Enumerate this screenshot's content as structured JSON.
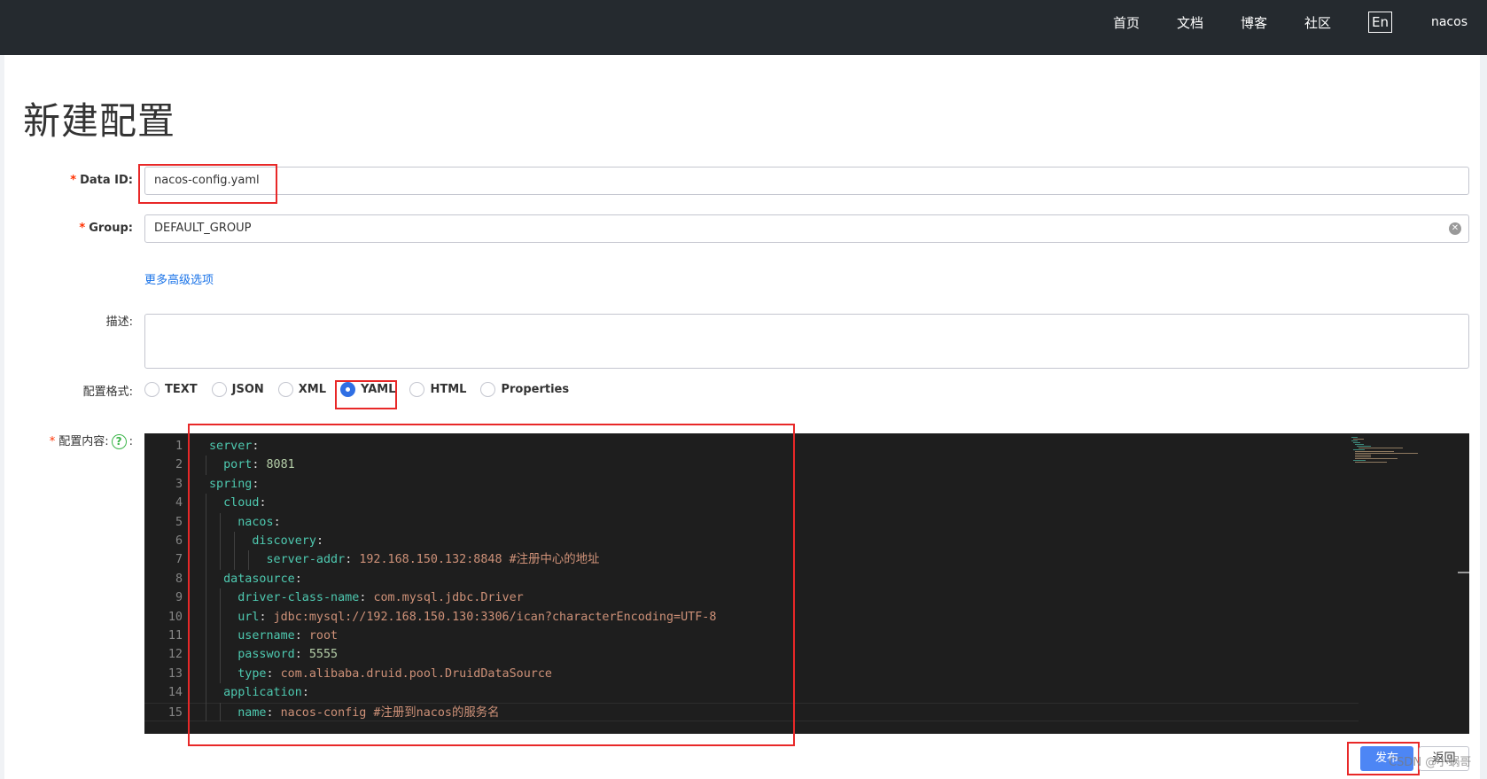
{
  "nav": {
    "items": [
      "首页",
      "文档",
      "博客",
      "社区"
    ],
    "lang": "En",
    "user": "nacos"
  },
  "page": {
    "title": "新建配置"
  },
  "form": {
    "data_id": {
      "label": "Data ID:",
      "value": "nacos-config.yaml"
    },
    "group": {
      "label": "Group:",
      "value": "DEFAULT_GROUP"
    },
    "more_options": "更多高级选项",
    "description": {
      "label": "描述:",
      "value": ""
    },
    "format": {
      "label": "配置格式:",
      "options": [
        "TEXT",
        "JSON",
        "XML",
        "YAML",
        "HTML",
        "Properties"
      ],
      "selected": "YAML"
    },
    "content": {
      "label": "配置内容:",
      "help": "?",
      "colon": ":"
    }
  },
  "editor": {
    "lines": [
      {
        "n": "1",
        "indent": "",
        "key": "server",
        "sep": ":",
        "val": "",
        "comment": ""
      },
      {
        "n": "2",
        "indent": "  ",
        "key": "port",
        "sep": ": ",
        "val": "8081",
        "comment": ""
      },
      {
        "n": "3",
        "indent": "",
        "key": "spring",
        "sep": ":",
        "val": "",
        "comment": ""
      },
      {
        "n": "4",
        "indent": "  ",
        "key": "cloud",
        "sep": ":",
        "val": "",
        "comment": ""
      },
      {
        "n": "5",
        "indent": "    ",
        "key": "nacos",
        "sep": ":",
        "val": "",
        "comment": ""
      },
      {
        "n": "6",
        "indent": "      ",
        "key": "discovery",
        "sep": ":",
        "val": "",
        "comment": ""
      },
      {
        "n": "7",
        "indent": "        ",
        "key": "server-addr",
        "sep": ": ",
        "val": "192.168.150.132:8848",
        "comment": " #注册中心的地址"
      },
      {
        "n": "8",
        "indent": "  ",
        "key": "datasource",
        "sep": ":",
        "val": "",
        "comment": ""
      },
      {
        "n": "9",
        "indent": "    ",
        "key": "driver-class-name",
        "sep": ": ",
        "val": "com.mysql.jdbc.Driver",
        "comment": ""
      },
      {
        "n": "10",
        "indent": "    ",
        "key": "url",
        "sep": ": ",
        "val": "jdbc:mysql://192.168.150.130:3306/ican?characterEncoding=UTF-8",
        "comment": ""
      },
      {
        "n": "11",
        "indent": "    ",
        "key": "username",
        "sep": ": ",
        "val": "root",
        "comment": ""
      },
      {
        "n": "12",
        "indent": "    ",
        "key": "password",
        "sep": ": ",
        "val": "5555",
        "comment": ""
      },
      {
        "n": "13",
        "indent": "    ",
        "key": "type",
        "sep": ": ",
        "val": "com.alibaba.druid.pool.DruidDataSource",
        "comment": ""
      },
      {
        "n": "14",
        "indent": "  ",
        "key": "application",
        "sep": ":",
        "val": "",
        "comment": ""
      },
      {
        "n": "15",
        "indent": "    ",
        "key": "name",
        "sep": ": ",
        "val": "nacos-config",
        "comment": " #注册到nacos的服务名"
      }
    ]
  },
  "actions": {
    "publish": "发布",
    "back": "返回"
  },
  "watermark": "CSDN @小蜗哥",
  "colors": {
    "primary": "#4d86f5",
    "highlight": "#e82828",
    "topbar": "#252a2f",
    "editor_bg": "#1e1e1e"
  }
}
